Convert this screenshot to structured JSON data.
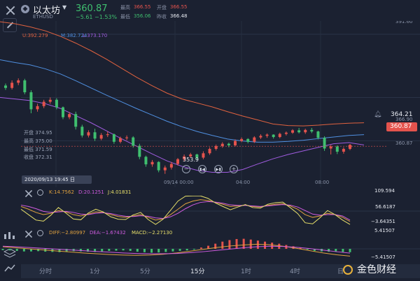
{
  "header": {
    "symbol_name": "以太坊",
    "symbol_code": "ETHUSD",
    "price": "360.87",
    "change": "−5.61",
    "change_pct": "−1.53%",
    "high_label": "最高",
    "high_value": "366.55",
    "open_label": "开盘",
    "open_value": "366.55",
    "low_label": "最低",
    "low_value": "356.06",
    "prev_label": "昨收",
    "prev_value": "366.48"
  },
  "legend": {
    "u": "U:392.279",
    "m": "M:382.724",
    "l": "L:373.170"
  },
  "ohlc_box": {
    "open": "开盘 374.95",
    "high": "最高 375.00",
    "low": "最低 371.59",
    "close": "收盘 372.31"
  },
  "markers": {
    "low_callout": "353.9",
    "alert_price": "364.21",
    "last_price": "360.87",
    "cursor_time": "2020/09/13 19:45 日"
  },
  "kdj": {
    "k": "K:14.7562",
    "d": "D:20.1251",
    "j": "J:4.01831",
    "top": "109.594",
    "mid": "56.6187",
    "bottom": "−3.64351"
  },
  "macd": {
    "diff": "DIFF:−2.80997",
    "dea": "DEA:−1.67432",
    "macd": "MACD:−2.27130",
    "top": "5.41507",
    "bottom": "−5.41507"
  },
  "tabs": [
    "分时",
    "1分",
    "5分",
    "15分",
    "1时",
    "4时",
    "日"
  ],
  "active_tab": "15分",
  "watermark": "金色财经",
  "colors": {
    "up": "#e4534d",
    "down": "#3fbf6f",
    "upper": "#e0623f",
    "middle": "#4f8fe0",
    "lower": "#a05ce0"
  },
  "chart_data": [
    {
      "type": "candlestick",
      "ylim": [
        350.5,
        392.5
      ],
      "y_ticks": [
        "391.60",
        "366.90",
        "360.87"
      ],
      "x_ticks": [
        "09/14 00:00",
        "04:00",
        "08:00"
      ],
      "series": [
        {
          "name": "U",
          "values": [
            392.3,
            391.8,
            391.0,
            390.0,
            388.6,
            386.9,
            385.0,
            382.9,
            380.6,
            378.3,
            376.2,
            374.3,
            372.8,
            371.8,
            370.8,
            369.6,
            368.5,
            367.5,
            366.5,
            366.1,
            366.0,
            366.2,
            366.5,
            366.7,
            366.8
          ]
        },
        {
          "name": "M",
          "values": [
            382.7,
            382.0,
            381.4,
            380.4,
            379.1,
            377.4,
            375.6,
            373.8,
            372.1,
            370.4,
            368.8,
            367.2,
            365.8,
            364.6,
            363.6,
            362.7,
            362.2,
            361.9,
            361.9,
            362.1,
            362.4,
            362.8,
            363.2,
            363.6,
            363.8
          ]
        },
        {
          "name": "L",
          "values": [
            373.2,
            372.8,
            372.4,
            371.6,
            370.4,
            368.6,
            366.8,
            364.8,
            362.8,
            360.9,
            359.0,
            357.2,
            355.8,
            354.8,
            354.3,
            354.3,
            355.0,
            356.4,
            357.7,
            358.8,
            359.7,
            360.6,
            361.5,
            361.8,
            361.2
          ]
        }
      ],
      "candles": [
        [
          376.2,
          376.7,
          375.1,
          375.6
        ],
        [
          375.6,
          377.5,
          375.2,
          376.9
        ],
        [
          376.9,
          378.0,
          376.3,
          377.5
        ],
        [
          377.5,
          377.9,
          374.0,
          374.5
        ],
        [
          374.5,
          375.0,
          369.2,
          370.2
        ],
        [
          370.2,
          371.6,
          369.6,
          371.0
        ],
        [
          371.0,
          372.6,
          370.5,
          372.1
        ],
        [
          372.1,
          373.2,
          371.6,
          372.6
        ],
        [
          372.6,
          373.0,
          370.2,
          370.7
        ],
        [
          370.7,
          370.9,
          367.7,
          368.2
        ],
        [
          368.2,
          369.5,
          367.7,
          369.0
        ],
        [
          369.0,
          369.6,
          365.1,
          365.8
        ],
        [
          365.8,
          366.3,
          363.1,
          363.6
        ],
        [
          363.6,
          364.9,
          363.1,
          364.4
        ],
        [
          364.4,
          365.3,
          362.2,
          362.8
        ],
        [
          362.8,
          364.2,
          362.4,
          363.7
        ],
        [
          363.7,
          364.6,
          363.2,
          363.9
        ],
        [
          363.9,
          364.1,
          361.5,
          362.0
        ],
        [
          362.0,
          363.3,
          361.6,
          362.9
        ],
        [
          362.9,
          363.6,
          362.4,
          363.1
        ],
        [
          363.1,
          363.4,
          360.5,
          361.0
        ],
        [
          361.0,
          361.5,
          357.6,
          358.2
        ],
        [
          358.2,
          358.5,
          355.7,
          356.3
        ],
        [
          356.3,
          357.4,
          355.7,
          356.9
        ],
        [
          356.9,
          357.1,
          354.3,
          354.8
        ],
        [
          354.8,
          356.0,
          353.9,
          355.5
        ],
        [
          355.5,
          356.9,
          355.0,
          356.4
        ],
        [
          356.4,
          357.9,
          356.0,
          357.6
        ],
        [
          357.6,
          358.8,
          357.1,
          358.3
        ],
        [
          358.3,
          359.2,
          357.9,
          358.8
        ],
        [
          358.8,
          359.0,
          357.5,
          358.0
        ],
        [
          358.0,
          359.6,
          357.6,
          359.1
        ],
        [
          359.1,
          360.6,
          358.7,
          360.2
        ],
        [
          360.2,
          361.3,
          359.8,
          360.9
        ],
        [
          360.9,
          361.9,
          360.5,
          361.5
        ],
        [
          361.5,
          361.8,
          360.6,
          361.1
        ],
        [
          361.1,
          362.6,
          360.8,
          362.2
        ],
        [
          362.2,
          363.1,
          361.9,
          362.7
        ],
        [
          362.7,
          362.9,
          361.6,
          362.0
        ],
        [
          362.0,
          363.4,
          361.7,
          363.1
        ],
        [
          363.1,
          363.9,
          362.7,
          363.5
        ],
        [
          363.5,
          364.1,
          363.0,
          363.8
        ],
        [
          363.8,
          363.9,
          362.8,
          363.2
        ],
        [
          363.2,
          364.3,
          362.9,
          364.0
        ],
        [
          364.0,
          364.6,
          363.6,
          364.3
        ],
        [
          364.3,
          365.2,
          364.0,
          364.9
        ],
        [
          364.9,
          365.5,
          364.1,
          364.4
        ],
        [
          364.4,
          365.3,
          364.0,
          365.0
        ],
        [
          365.0,
          365.5,
          364.2,
          364.6
        ],
        [
          364.6,
          364.8,
          362.6,
          363.0
        ],
        [
          363.0,
          363.4,
          359.7,
          360.3
        ],
        [
          360.3,
          361.2,
          358.8,
          360.8
        ],
        [
          360.8,
          361.1,
          358.9,
          359.5
        ],
        [
          359.5,
          360.6,
          359.0,
          360.2
        ],
        [
          360.2,
          361.4,
          359.9,
          360.9
        ]
      ]
    },
    {
      "type": "line",
      "name": "KDJ",
      "ylim": [
        -3.64351,
        109.594
      ],
      "series": [
        {
          "name": "K",
          "values": [
            70,
            60,
            48,
            40,
            45,
            55,
            50,
            40,
            35,
            42,
            50,
            48,
            40,
            33,
            30,
            35,
            40,
            30,
            20,
            25,
            40,
            60,
            80,
            90,
            95,
            92,
            85,
            78,
            70,
            72,
            75,
            70,
            68,
            74,
            78,
            80,
            72,
            60,
            40,
            30,
            35,
            45,
            40,
            30,
            14.8
          ]
        },
        {
          "name": "D",
          "values": [
            75,
            70,
            62,
            52,
            48,
            50,
            52,
            48,
            42,
            40,
            45,
            47,
            44,
            38,
            34,
            33,
            36,
            34,
            28,
            26,
            32,
            45,
            62,
            76,
            85,
            88,
            86,
            82,
            76,
            74,
            74,
            72,
            70,
            72,
            75,
            77,
            75,
            68,
            55,
            42,
            38,
            40,
            40,
            35,
            20.1
          ]
        },
        {
          "name": "J",
          "values": [
            60,
            40,
            20,
            16,
            38,
            66,
            46,
            24,
            21,
            46,
            60,
            50,
            32,
            23,
            22,
            39,
            48,
            22,
            4,
            23,
            56,
            90,
            108,
            109,
            109,
            100,
            83,
            70,
            58,
            68,
            77,
            66,
            64,
            78,
            84,
            86,
            66,
            44,
            10,
            6,
            29,
            55,
            40,
            20,
            4.0
          ]
        }
      ]
    },
    {
      "type": "bar",
      "name": "MACD",
      "ylim": [
        -5.41507,
        5.41507
      ],
      "series": [
        {
          "name": "MACD",
          "values": [
            -0.5,
            -0.6,
            -0.8,
            -1.0,
            -1.0,
            -0.9,
            -1.1,
            -1.2,
            -1.3,
            -1.1,
            -0.9,
            -1.0,
            -1.1,
            -1.2,
            -1.0,
            -0.8,
            -0.7,
            -0.6,
            -0.8,
            -1.1,
            -1.3,
            -1.5,
            -1.4,
            -1.2,
            -1.0,
            -0.8,
            -0.6,
            -0.3,
            0.5,
            1.2,
            2.0,
            2.8,
            3.4,
            3.8,
            3.9,
            3.6,
            3.2,
            2.8,
            2.4,
            2.0,
            1.5,
            1.0,
            0.4,
            -0.3,
            -0.8,
            -1.0,
            -1.1,
            -1.0,
            -1.2,
            -1.3
          ]
        },
        {
          "name": "DIFF",
          "values": [
            0.8,
            0.4,
            0.0,
            -0.4,
            -0.8,
            -1.2,
            -1.6,
            -1.9,
            -2.2,
            -2.4,
            -2.5,
            -2.4,
            -2.1,
            -1.6,
            -0.9,
            -0.2,
            0.5,
            1.1,
            1.5,
            1.8,
            1.6,
            1.0,
            0.2,
            -0.7,
            -1.6,
            -2.3,
            -2.81
          ]
        },
        {
          "name": "DEA",
          "values": [
            1.0,
            0.8,
            0.5,
            0.2,
            -0.1,
            -0.4,
            -0.7,
            -1.0,
            -1.3,
            -1.6,
            -1.8,
            -1.9,
            -1.9,
            -1.8,
            -1.5,
            -1.1,
            -0.6,
            -0.1,
            0.4,
            0.8,
            1.0,
            0.9,
            0.6,
            0.1,
            -0.5,
            -1.1,
            -1.67
          ]
        }
      ]
    }
  ]
}
